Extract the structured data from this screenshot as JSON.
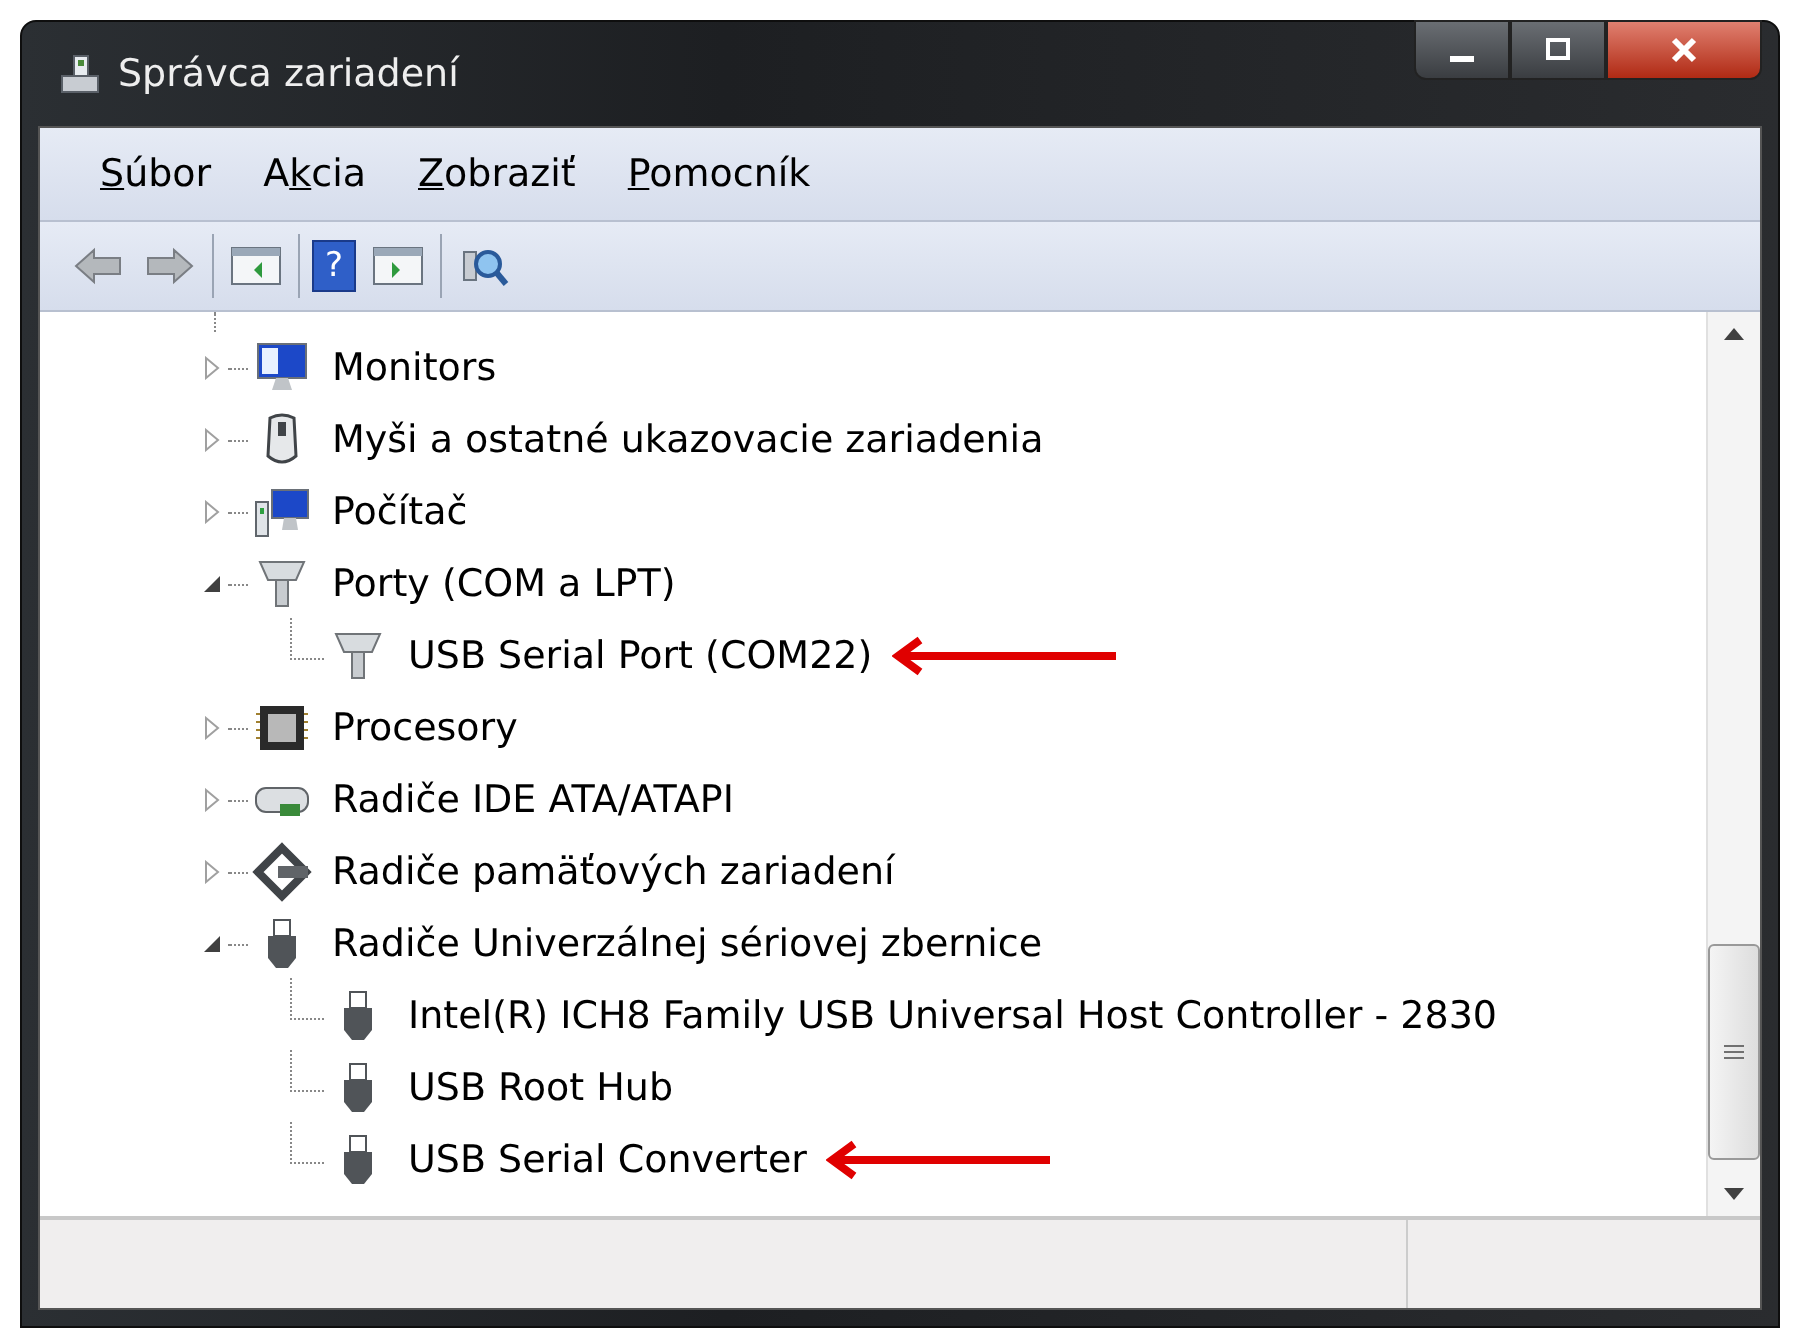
{
  "window": {
    "title": "Správca zariadení"
  },
  "menu": [
    {
      "key": "S",
      "after": "úbor"
    },
    {
      "before": "A",
      "key": "k",
      "after": "cia"
    },
    {
      "key": "Z",
      "after": "obraziť"
    },
    {
      "key": "P",
      "after": "omocník"
    }
  ],
  "toolbar": [
    {
      "kind": "back",
      "disabled": true
    },
    {
      "kind": "forward",
      "disabled": true
    },
    {
      "kind": "separator"
    },
    {
      "kind": "console"
    },
    {
      "kind": "separator"
    },
    {
      "kind": "help",
      "label": "?"
    },
    {
      "kind": "action"
    },
    {
      "kind": "separator"
    },
    {
      "kind": "scan"
    }
  ],
  "tree": [
    {
      "label": "Monitors",
      "kind": "monitor",
      "expanded": false
    },
    {
      "label": "Myši a ostatné ukazovacie zariadenia",
      "kind": "mouse",
      "expanded": false
    },
    {
      "label": "Počítač",
      "kind": "computer",
      "expanded": false
    },
    {
      "label": "Porty (COM a LPT)",
      "kind": "port",
      "expanded": true,
      "children": [
        {
          "label": "USB Serial Port (COM22)",
          "kind": "port",
          "arrow": true
        }
      ]
    },
    {
      "label": "Procesory",
      "kind": "cpu",
      "expanded": false
    },
    {
      "label": "Radiče IDE ATA/ATAPI",
      "kind": "ide",
      "expanded": false
    },
    {
      "label": "Radiče pamäťových zariadení",
      "kind": "storage",
      "expanded": false
    },
    {
      "label": "Radiče Univerzálnej sériovej zbernice",
      "kind": "usb",
      "expanded": true,
      "children": [
        {
          "label": "Intel(R) ICH8 Family USB Universal Host Controller - 2830",
          "kind": "usb",
          "arrow": false
        },
        {
          "label": "USB Root Hub",
          "kind": "usb",
          "arrow": false
        },
        {
          "label": "USB Serial Converter",
          "kind": "usb",
          "arrow": true
        }
      ]
    }
  ]
}
